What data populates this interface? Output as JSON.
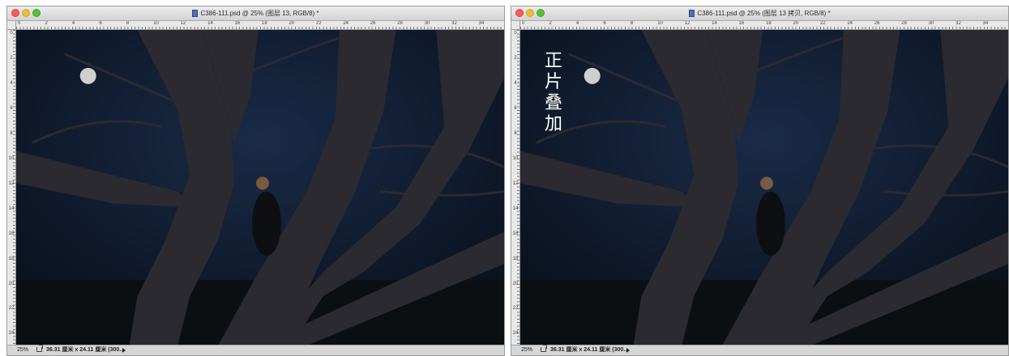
{
  "left_window": {
    "title": "C386-111.psd @ 25% (图层 13, RGB/8) *",
    "zoom": "25%",
    "doc_size": "36.31 厘米 x 24.11 厘米 (300..."
  },
  "right_window": {
    "title": "C386-111.psd @ 25% (图层 13 拷贝, RGB/8) *",
    "zoom": "25%",
    "doc_size": "36.31 厘米 x 24.11 厘米 (300...",
    "overlay_text": [
      "正",
      "片",
      "叠",
      "加"
    ]
  },
  "ruler": {
    "horizontal": [
      "0",
      "2",
      "4",
      "6",
      "8",
      "10",
      "12",
      "14",
      "16",
      "18",
      "20",
      "22",
      "24",
      "26",
      "28",
      "30",
      "32",
      "34"
    ],
    "vertical": [
      "0",
      "2",
      "4",
      "6",
      "8",
      "10",
      "12",
      "14",
      "16",
      "18",
      "20",
      "22",
      "24"
    ]
  },
  "colors": {
    "sky": "#0b1322",
    "tree": "#2a2a30",
    "moon": "#cfcfcf",
    "close": "#fc5b57",
    "minimize": "#e5bf3c",
    "maximize": "#57c038"
  }
}
